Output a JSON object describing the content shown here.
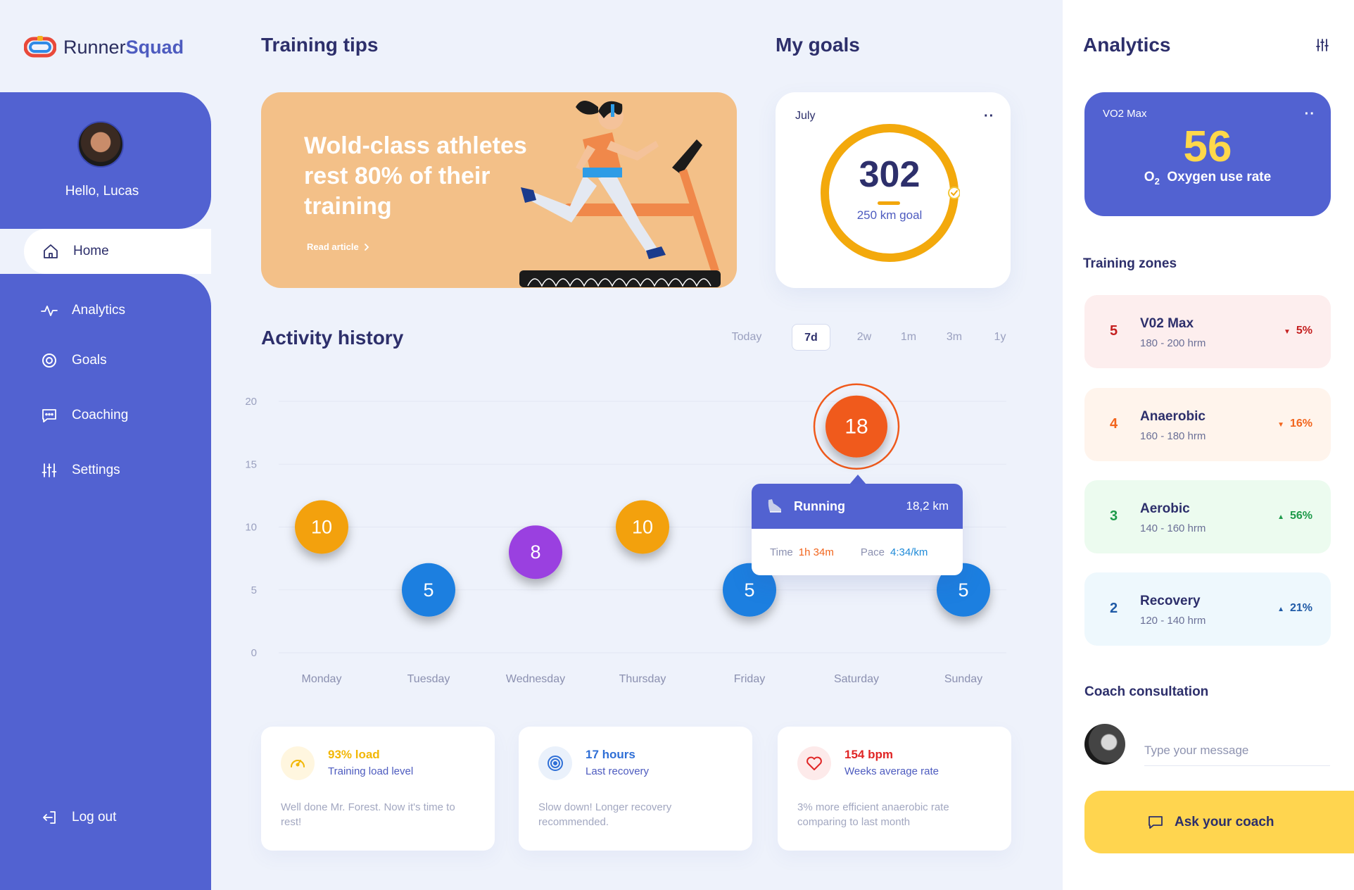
{
  "app": {
    "logo_light": "Runner",
    "logo_bold": "Squad"
  },
  "user": {
    "greeting": "Hello, Lucas"
  },
  "nav": {
    "home": "Home",
    "analytics": "Analytics",
    "goals": "Goals",
    "coaching": "Coaching",
    "settings": "Settings",
    "logout": "Log out"
  },
  "tips": {
    "title": "Training tips",
    "headline": "Wold-class athletes rest 80% of their training",
    "link": "Read article"
  },
  "goals": {
    "title": "My goals",
    "month": "July",
    "value": "302",
    "goal_label": "250 km goal",
    "progress": 1.0
  },
  "activity": {
    "title": "Activity history",
    "ranges": [
      "Today",
      "7d",
      "2w",
      "1m",
      "3m",
      "1y"
    ],
    "active_range": "7d"
  },
  "chart_data": {
    "type": "scatter",
    "categories": [
      "Monday",
      "Tuesday",
      "Wednesday",
      "Thursday",
      "Friday",
      "Saturday",
      "Sunday"
    ],
    "values": [
      10,
      5,
      8,
      10,
      5,
      18,
      5
    ],
    "yticks": [
      0,
      5,
      10,
      15,
      20
    ],
    "ylim": [
      0,
      20
    ],
    "grid": true,
    "point_colors": [
      "#f3a10d",
      "#1e7fe0",
      "#9a3fe0",
      "#f3a10d",
      "#1e7fe0",
      "#f05a1c",
      "#1e7fe0"
    ],
    "highlighted": "Saturday"
  },
  "tooltip": {
    "activity": "Running",
    "distance": "18,2 km",
    "time_label": "Time",
    "time_value": "1h 34m",
    "pace_label": "Pace",
    "pace_value": "4:34/km"
  },
  "stats": [
    {
      "value": "93% load",
      "label": "Training load level",
      "desc": "Well done Mr. Forest. Now it's time to rest!",
      "color": "#f2b705",
      "icon": "speedometer-icon"
    },
    {
      "value": "17 hours",
      "label": "Last recovery",
      "desc": "Slow down! Longer recovery recommended.",
      "color": "#2f6fd6",
      "icon": "target-icon"
    },
    {
      "value": "154 bpm",
      "label": "Weeks average rate",
      "desc": "3% more efficient  anaerobic rate comparing to last month",
      "color": "#e02626",
      "icon": "heart-icon"
    }
  ],
  "analytics": {
    "title": "Analytics",
    "vo2_label": "VO2 Max",
    "vo2_value": "56",
    "vo2_sub": "Oxygen use rate",
    "vo2_sub_symbol": "O",
    "vo2_sub_subscript": "2"
  },
  "zones": {
    "title": "Training zones",
    "items": [
      {
        "num": "5",
        "name": "V02 Max",
        "range": "180 - 200 hrm",
        "pct": "5%",
        "trend": "down",
        "color": "#c41f1f",
        "bg": "#fdeeee"
      },
      {
        "num": "4",
        "name": "Anaerobic",
        "range": "160 - 180 hrm",
        "pct": "16%",
        "trend": "down",
        "color": "#f2651d",
        "bg": "#fff4ec"
      },
      {
        "num": "3",
        "name": "Aerobic",
        "range": "140 - 160 hrm",
        "pct": "56%",
        "trend": "up",
        "color": "#1e9a4a",
        "bg": "#ecfbef"
      },
      {
        "num": "2",
        "name": "Recovery",
        "range": "120 - 140 hrm",
        "pct": "21%",
        "trend": "up",
        "color": "#1f5aa6",
        "bg": "#eef8fd"
      }
    ]
  },
  "coach": {
    "title": "Coach consultation",
    "placeholder": "Type your message",
    "button": "Ask your coach"
  }
}
